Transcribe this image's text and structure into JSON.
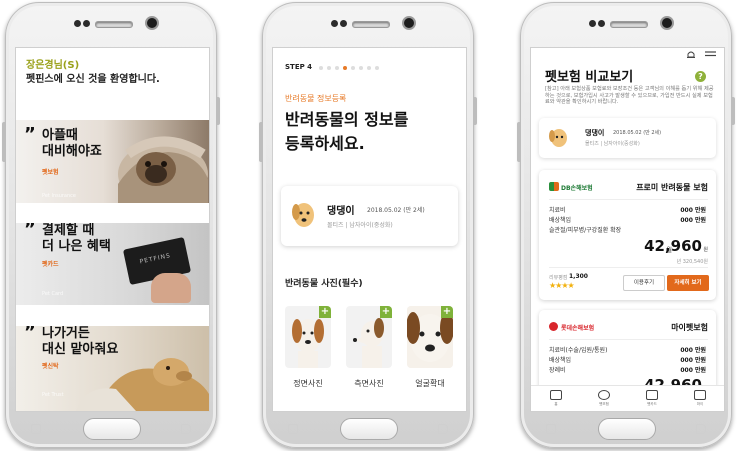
{
  "screen1": {
    "welcome_name": "장은경님(S)",
    "welcome_msg": "펫핀스에 오신 것을 환영합니다.",
    "cards": [
      {
        "quote": "”",
        "line1": "아플때",
        "line2": "대비해야죠",
        "tag": "펫보험",
        "sub": "Pet Insurance"
      },
      {
        "quote": "”",
        "line1": "결제할 때",
        "line2": "더 나은 혜택",
        "tag": "펫카드",
        "sub": "Pet Card"
      },
      {
        "quote": "”",
        "line1": "나가거든",
        "line2": "대신 맡아줘요",
        "tag": "펫신탁",
        "sub": "Pet Trust"
      }
    ],
    "card_text": "PETFINS"
  },
  "screen2": {
    "step": "STEP 4",
    "subtitle": "반려동물 정보등록",
    "title_line1": "반려동물의 정보를",
    "title_line2": "등록하세요.",
    "pet": {
      "name": "댕댕이",
      "birth": "2018.05.02 (만 2세)",
      "breed": "몰티즈 | 남자아이(중성화)"
    },
    "photo_label": "반려동물 사진(필수)",
    "photos": [
      {
        "caption": "정면사진",
        "plus": "+"
      },
      {
        "caption": "측면사진",
        "plus": "+"
      },
      {
        "caption": "얼굴확대",
        "plus": "+"
      }
    ],
    "progress_dots": 8,
    "active_dot": 3
  },
  "screen3": {
    "title": "펫보험 비교보기",
    "help": "?",
    "description": "[참고] 아래 보험상품 보험료와 보장조건 등은 고객님의 이해를 돕기 위해 제공하는 것으로, 보험가입시 사고가 발생할 수 있으므로, 가입전 반드시 실제 보험료와 약관을 확인하시기 바랍니다.",
    "pet": {
      "name": "댕댕이",
      "birth": "2018.05.02 (만 2세)",
      "breed": "몰티즈 | 남자아이(중성화)"
    },
    "product1": {
      "insurer": "DB손해보험",
      "name": "프로미 반려동물 보험",
      "rows": [
        {
          "label": "치료비",
          "value": "000 만원"
        },
        {
          "label": "배상책임",
          "value": "000 만원"
        },
        {
          "label": "슬관절/피부병/구강질환 확장",
          "value": ""
        }
      ],
      "month_label": "월",
      "price": "42,960",
      "price_unit": "원",
      "yearly": "년 320,540원",
      "review_label": "리뷰평점",
      "review_count": "1,300",
      "stars": "★★★★",
      "btn_review": "이용후기",
      "btn_detail": "자세히 보기"
    },
    "product2": {
      "insurer": "롯데손해보험",
      "name": "마이펫보험",
      "rows": [
        {
          "label": "치료비(수술/입원/통원)",
          "value": "000 만원"
        },
        {
          "label": "배상책임",
          "value": "000 만원"
        },
        {
          "label": "장례비",
          "value": "000 만원"
        }
      ],
      "price_partial": "42,960"
    },
    "tabs": [
      "홈",
      "펫보험",
      "펫카드",
      "마이"
    ],
    "colors": {
      "accent": "#e2691b",
      "green": "#8fb13a"
    }
  }
}
